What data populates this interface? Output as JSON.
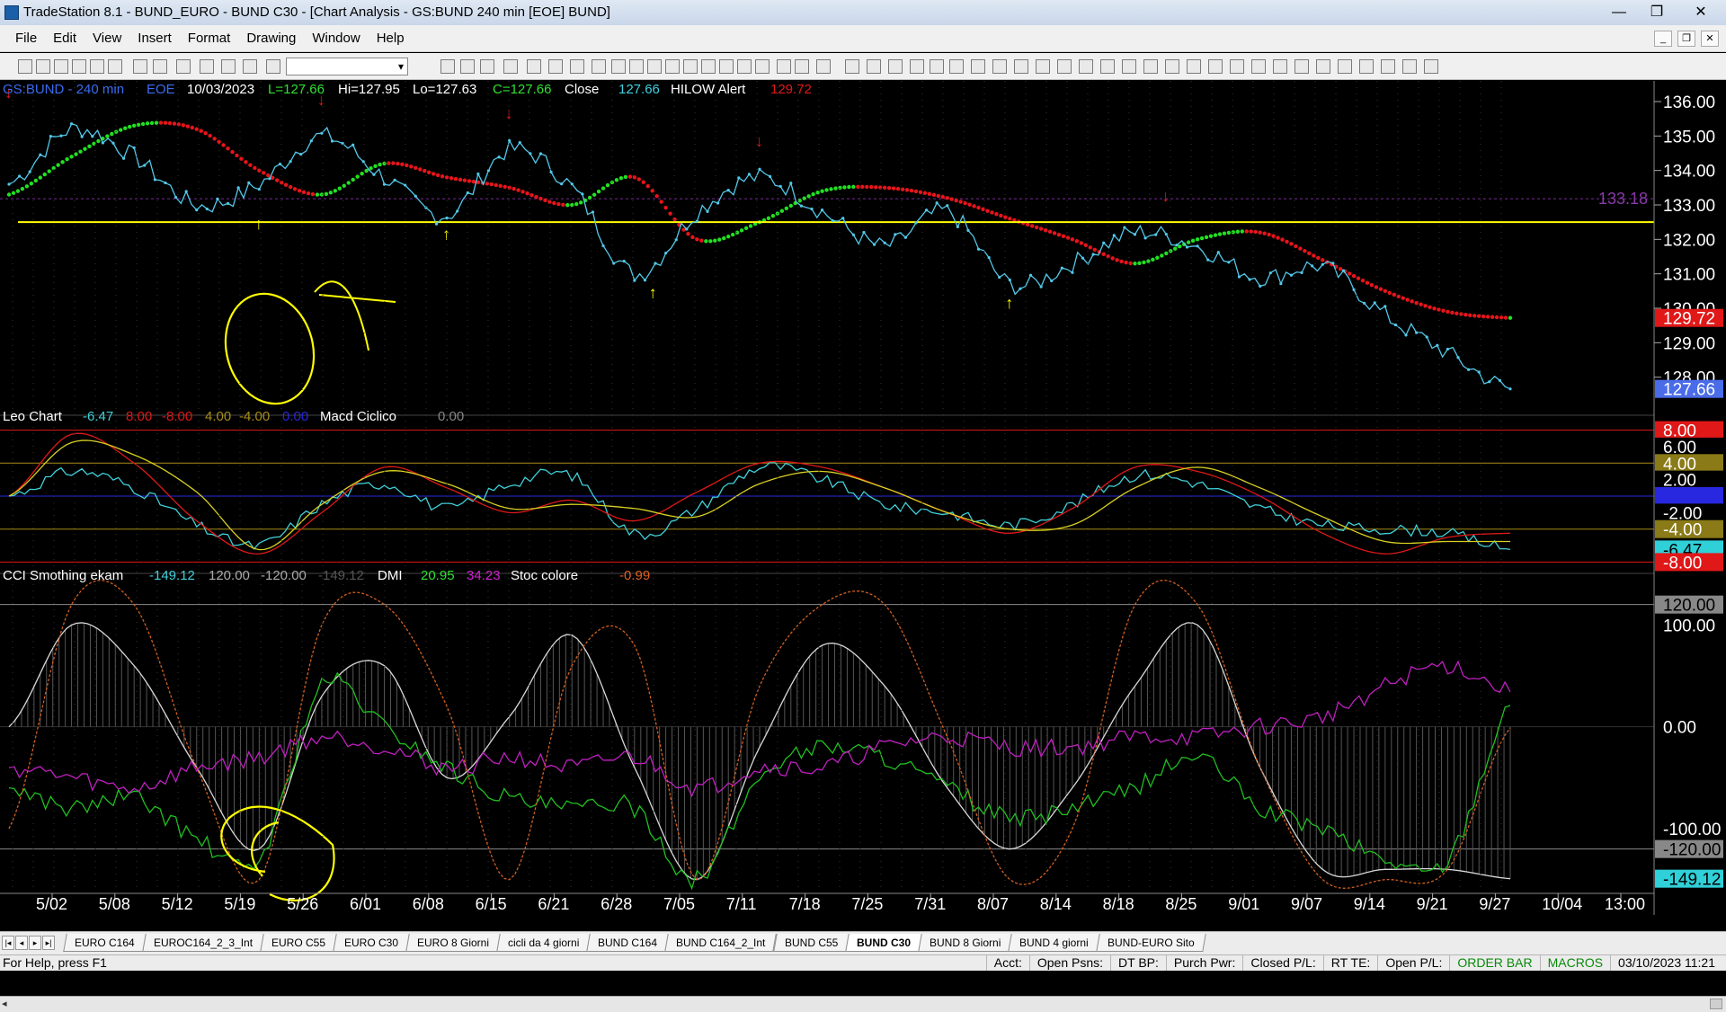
{
  "window": {
    "title": "TradeStation 8.1 - BUND_EURO - BUND  C30 - [Chart Analysis - GS:BUND  240 min  [EOE] BUND]",
    "buttons": [
      "—",
      "❐",
      "✕"
    ]
  },
  "menu": [
    "File",
    "Edit",
    "View",
    "Insert",
    "Format",
    "Drawing",
    "Window",
    "Help"
  ],
  "chart_header": {
    "symbol": "GS:BUND - 240 min",
    "session": "EOE",
    "date": "10/03/2023",
    "last": "L=127.66",
    "high": "Hi=127.95",
    "low": "Lo=127.63",
    "close": "C=127.66",
    "close_label": "Close",
    "close_value": "127.66",
    "indicator": "HILOW Alert",
    "indicator_value": "129.72"
  },
  "panel2_header": {
    "name": "Leo Chart",
    "v1": "-6.47",
    "v2": "8.00",
    "v3": "-8.00",
    "v4": "4.00",
    "v5": "-4.00",
    "v6": "0.00",
    "name2": "Macd Ciclico",
    "v7": "0.00"
  },
  "panel3_header": {
    "name": "CCI Smothing ekam",
    "v1": "-149.12",
    "v2": "120.00",
    "v3": "-120.00",
    "v4": "-149.12",
    "dmi": "DMI",
    "dmi1": "20.95",
    "dmi2": "34.23",
    "stoc": "Stoc colore",
    "stoc1": "-0.99"
  },
  "x_labels": [
    "5/02",
    "5/08",
    "5/12",
    "5/19",
    "5/26",
    "6/01",
    "6/08",
    "6/15",
    "6/21",
    "6/28",
    "7/05",
    "7/11",
    "7/18",
    "7/25",
    "7/31",
    "8/07",
    "8/14",
    "8/18",
    "8/25",
    "9/01",
    "9/07",
    "9/14",
    "9/21",
    "9/27",
    "10/04",
    "13:00"
  ],
  "price_axis": [
    "136.00",
    "135.00",
    "134.00",
    "133.00",
    "132.00",
    "131.00",
    "130.00",
    "129.00",
    "128.00"
  ],
  "price_tags": {
    "hilow": "129.72",
    "last": "127.66",
    "line": "133.18"
  },
  "osc_axis": [
    "8.00",
    "6.00",
    "4.00",
    "2.00",
    "0.00",
    "-2.00",
    "-4.00",
    "-6.47",
    "-8.00"
  ],
  "cci_axis": [
    "120.00",
    "100.00",
    "0.00",
    "-100.00",
    "-120.00",
    "-149.12"
  ],
  "tabs": [
    "EURO C164",
    "EUROC164_2_3_Int",
    "EURO C55",
    "EURO C30",
    "EURO 8 Giorni",
    "cicli da 4 giorni",
    "BUND C164",
    "BUND C164_2_Int",
    "BUND C55",
    "BUND  C30",
    "BUND 8 Giorni",
    "BUND 4 giorni",
    "BUND-EURO Sito"
  ],
  "active_tab": 9,
  "status": {
    "help": "For Help, press F1",
    "cells": [
      "Acct:",
      "Open Psns:",
      "DT BP:",
      "Purch Pwr:",
      "Closed P/L:",
      "RT TE:",
      "Open P/L:"
    ],
    "order_bar": "ORDER BAR",
    "macros": "MACROS",
    "datetime": "03/10/2023 11:21"
  },
  "colors": {
    "price": "#52c8e8",
    "hilow_up": "#22e022",
    "hilow_down": "#e8141a",
    "support": "#ffff00",
    "osc_cyan": "#40d0d8",
    "osc_red": "#e01818",
    "osc_yellow": "#d8d020",
    "cci_white": "#d8d8d8",
    "dmi_green": "#20c020",
    "dmi_magenta": "#c020c0",
    "stoc_orange": "#d06020"
  },
  "chart_data": [
    {
      "type": "line",
      "title": "GS:BUND - 240 min",
      "ylim": [
        127.0,
        136.6
      ],
      "x": [
        "5/02",
        "5/08",
        "5/12",
        "5/19",
        "5/26",
        "6/01",
        "6/08",
        "6/15",
        "6/21",
        "6/28",
        "7/05",
        "7/11",
        "7/18",
        "7/25",
        "7/31",
        "8/07",
        "8/14",
        "8/18",
        "8/25",
        "9/01",
        "9/07",
        "9/14",
        "9/21",
        "9/27",
        "10/03"
      ],
      "series": [
        {
          "name": "Close",
          "values": [
            133.6,
            135.2,
            134.4,
            133.0,
            133.6,
            135.0,
            133.8,
            132.7,
            134.6,
            133.5,
            131.0,
            132.8,
            133.8,
            132.8,
            131.8,
            132.8,
            130.7,
            131.3,
            132.2,
            131.8,
            130.9,
            131.2,
            129.8,
            128.7,
            127.66
          ]
        },
        {
          "name": "HILOW Alert",
          "values": [
            133.3,
            134.4,
            135.3,
            135.2,
            134.0,
            133.3,
            134.2,
            133.8,
            133.5,
            133.0,
            133.8,
            132.0,
            132.5,
            133.4,
            133.5,
            133.2,
            132.6,
            132.0,
            131.3,
            132.0,
            132.2,
            131.4,
            130.5,
            129.9,
            129.72
          ]
        }
      ],
      "support_level": 132.5,
      "reference_line": 133.18,
      "sell_arrows": [
        "5/02",
        "6/01",
        "6/21",
        "7/18",
        "8/28"
      ],
      "buy_arrows": [
        "5/26",
        "6/15",
        "7/07",
        "8/14"
      ]
    },
    {
      "type": "line",
      "title": "Leo Chart / Macd Ciclico",
      "ylim": [
        -8.5,
        8.5
      ],
      "levels": [
        8.0,
        4.0,
        0.0,
        -4.0,
        -8.0
      ],
      "x": [
        "5/02",
        "5/08",
        "5/12",
        "5/19",
        "5/26",
        "6/01",
        "6/08",
        "6/15",
        "6/21",
        "6/28",
        "7/05",
        "7/11",
        "7/18",
        "7/25",
        "7/31",
        "8/07",
        "8/14",
        "8/18",
        "8/25",
        "9/01",
        "9/07",
        "9/14",
        "9/21",
        "9/27",
        "10/03"
      ],
      "series": [
        {
          "name": "Leo Chart",
          "values": [
            0.0,
            3.0,
            1.0,
            -3.5,
            -6.0,
            -1.0,
            1.5,
            -1.5,
            1.5,
            2.5,
            -4.5,
            -1.5,
            3.5,
            2.0,
            -1.0,
            -2.0,
            -3.5,
            -1.0,
            2.5,
            1.5,
            -1.5,
            -3.5,
            -4.0,
            -4.5,
            -6.47
          ]
        },
        {
          "name": "Red",
          "values": [
            0,
            7.5,
            4.0,
            -3.0,
            -7.0,
            -2.0,
            3.5,
            1.0,
            -2.0,
            -0.5,
            -3.0,
            0.5,
            4.0,
            3.5,
            1.0,
            -2.0,
            -4.5,
            -1.5,
            3.5,
            3.0,
            0.0,
            -4.5,
            -7.0,
            -5.0,
            -4.5
          ]
        },
        {
          "name": "Yellow",
          "values": [
            0,
            6.5,
            5.0,
            0.5,
            -6.5,
            -1.0,
            3.0,
            1.5,
            -1.5,
            -1.0,
            -1.5,
            -2.5,
            1.5,
            3.0,
            1.0,
            -2.0,
            -4.0,
            -3.5,
            1.0,
            3.5,
            1.0,
            -2.5,
            -5.5,
            -5.5,
            -5.5
          ]
        }
      ]
    },
    {
      "type": "line",
      "title": "CCI Smothing ekam / DMI / Stoc colore",
      "ylim": [
        -160,
        140
      ],
      "levels": [
        120,
        0,
        -120
      ],
      "x": [
        "5/02",
        "5/08",
        "5/12",
        "5/19",
        "5/26",
        "6/01",
        "6/08",
        "6/15",
        "6/21",
        "6/28",
        "7/05",
        "7/11",
        "7/18",
        "7/25",
        "7/31",
        "8/07",
        "8/14",
        "8/18",
        "8/25",
        "9/01",
        "9/07",
        "9/14",
        "9/21",
        "9/27",
        "10/03"
      ],
      "series": [
        {
          "name": "CCI Smothing ekam",
          "values": [
            0,
            100,
            60,
            -40,
            -120,
            30,
            60,
            -50,
            10,
            90,
            -40,
            -150,
            -20,
            80,
            40,
            -60,
            -120,
            -60,
            40,
            100,
            -40,
            -140,
            -140,
            -140,
            -149.12
          ]
        },
        {
          "name": "DMI +",
          "values": [
            -60,
            -80,
            -70,
            -110,
            -130,
            40,
            0,
            -40,
            -70,
            -80,
            -80,
            -150,
            -50,
            -20,
            -30,
            -60,
            -90,
            -80,
            -60,
            -30,
            -80,
            -100,
            -130,
            -130,
            20.95
          ]
        },
        {
          "name": "DMI -",
          "values": [
            -40,
            -50,
            -60,
            -40,
            -30,
            -10,
            -20,
            -40,
            -30,
            -40,
            -30,
            -60,
            -40,
            -40,
            -20,
            -10,
            -20,
            -20,
            -10,
            -10,
            0,
            10,
            40,
            60,
            34.23
          ]
        },
        {
          "name": "Stoc colore",
          "values": [
            -100,
            120,
            120,
            -40,
            -150,
            100,
            120,
            20,
            -150,
            60,
            80,
            -150,
            40,
            120,
            120,
            -10,
            -150,
            -100,
            120,
            120,
            -40,
            -150,
            -150,
            -140,
            -0.99
          ]
        }
      ]
    }
  ]
}
